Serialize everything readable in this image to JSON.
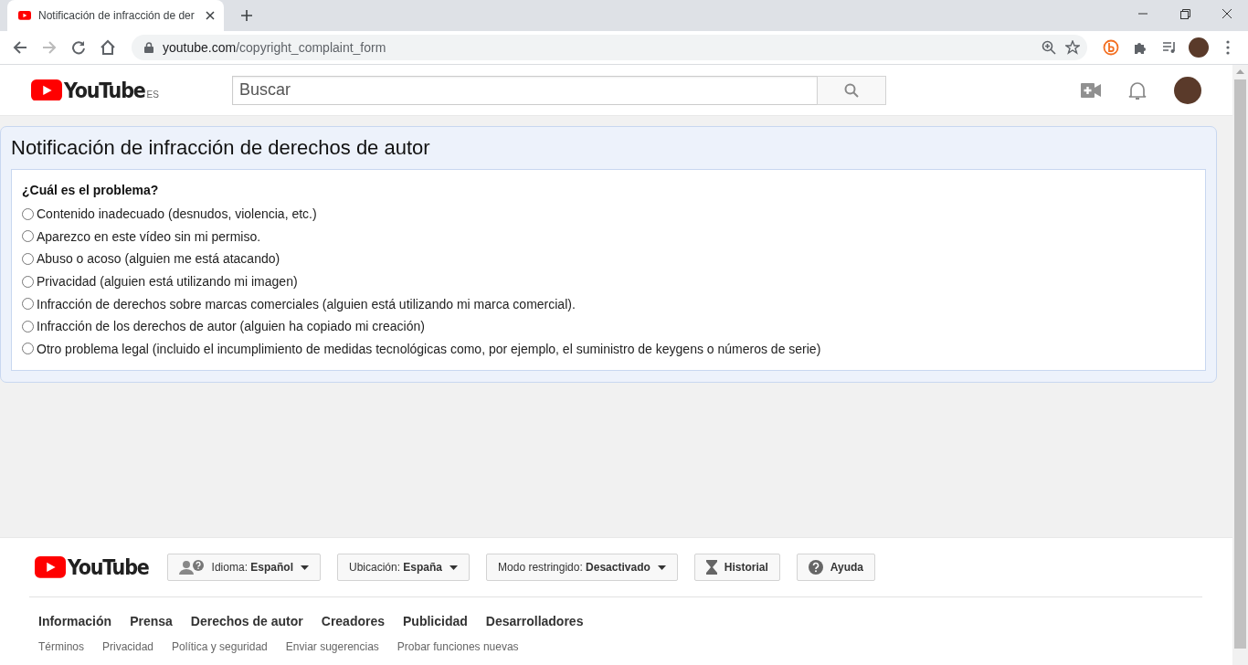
{
  "browser": {
    "tab": {
      "title": "Notificación de infracción de der"
    },
    "url": {
      "domain": "youtube.com",
      "path": "/copyright_complaint_form"
    }
  },
  "header": {
    "logo": "YouTube",
    "region": "ES",
    "search": {
      "placeholder": "Buscar"
    }
  },
  "form": {
    "title": "Notificación de infracción de derechos de autor",
    "question": "¿Cuál es el problema?",
    "options": [
      {
        "label": "Contenido inadecuado (desnudos, violencia, etc.)",
        "selected": false
      },
      {
        "label": "Aparezco en este vídeo sin mi permiso.",
        "selected": false
      },
      {
        "label": "Abuso o acoso (alguien me está atacando)",
        "selected": false
      },
      {
        "label": "Privacidad (alguien está utilizando mi imagen)",
        "selected": false
      },
      {
        "label": "Infracción de derechos sobre marcas comerciales (alguien está utilizando mi marca comercial).",
        "selected": false
      },
      {
        "label": "Infracción de los derechos de autor (alguien ha copiado mi creación)",
        "selected": false
      },
      {
        "label": "Otro problema legal (incluido el incumplimiento de medidas tecnológicas como, por ejemplo, el suministro de keygens o números de serie)",
        "selected": false
      }
    ]
  },
  "footer": {
    "logo": "YouTube",
    "buttons": [
      {
        "kind": "language",
        "label": "Idioma: **Español**"
      },
      {
        "kind": "dropdown",
        "label": "Ubicación: **España**"
      },
      {
        "kind": "dropdown",
        "label": "Modo restringido: **Desactivado**"
      },
      {
        "kind": "history",
        "label": "Historial"
      },
      {
        "kind": "help",
        "label": "Ayuda"
      }
    ],
    "primary_links": [
      "Información",
      "Prensa",
      "Derechos de autor",
      "Creadores",
      "Publicidad",
      "Desarrolladores"
    ],
    "secondary_links": [
      "Términos",
      "Privacidad",
      "Política y seguridad",
      "Enviar sugerencias",
      "Probar funciones nuevas"
    ]
  }
}
